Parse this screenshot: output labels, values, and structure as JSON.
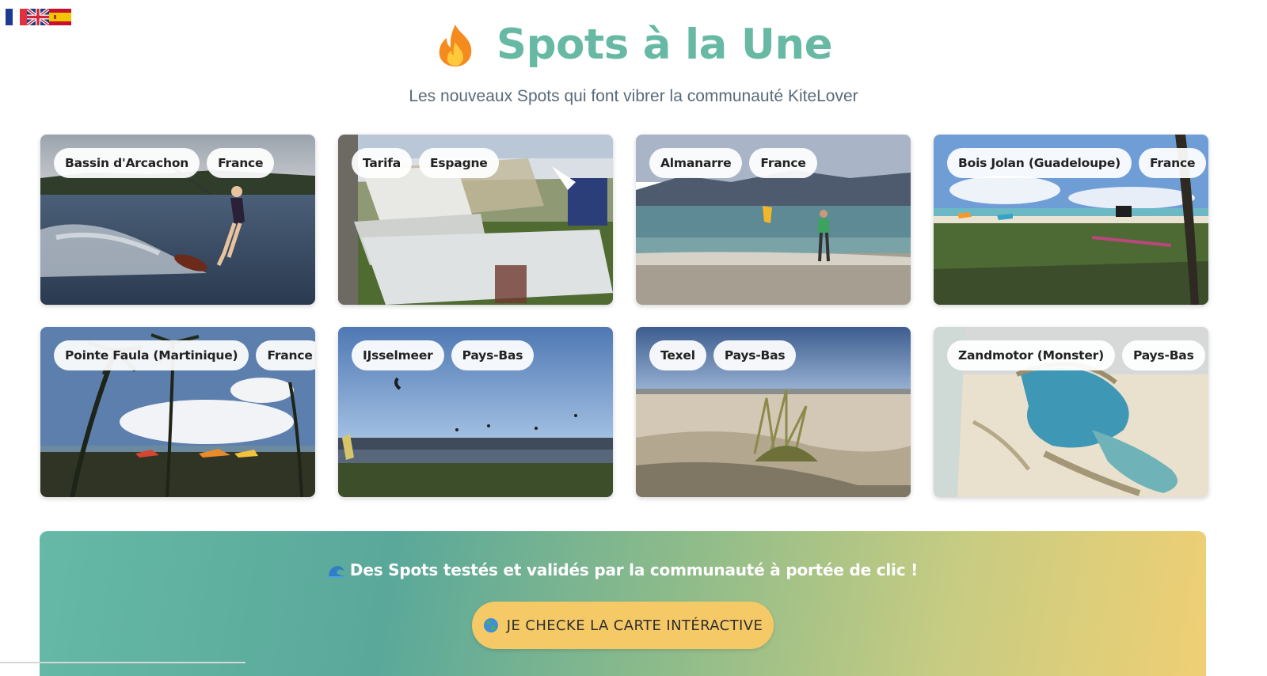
{
  "languages": [
    {
      "code": "fr",
      "icon": "france-flag-icon"
    },
    {
      "code": "en",
      "icon": "uk-flag-icon"
    },
    {
      "code": "es",
      "icon": "spain-flag-icon"
    }
  ],
  "header": {
    "icon": "fire-icon",
    "title": "Spots à la Une",
    "subtitle": "Les nouveaux Spots qui font vibrer la communauté KiteLover"
  },
  "spots": [
    {
      "name": "Bassin d'Arcachon",
      "country": "France"
    },
    {
      "name": "Tarifa",
      "country": "Espagne"
    },
    {
      "name": "Almanarre",
      "country": "France"
    },
    {
      "name": "Bois Jolan (Guadeloupe)",
      "country": "France"
    },
    {
      "name": "Pointe Faula (Martinique)",
      "country": "France"
    },
    {
      "name": "IJsselmeer",
      "country": "Pays-Bas"
    },
    {
      "name": "Texel",
      "country": "Pays-Bas"
    },
    {
      "name": "Zandmotor (Monster)",
      "country": "Pays-Bas"
    }
  ],
  "cta": {
    "icon": "wave-icon",
    "text": "Des Spots testés et validés par la communauté à portée de clic !",
    "button_icon": "globe-icon",
    "button_label": "JE CHECKE LA CARTE INTÉRACTIVE"
  },
  "colors": {
    "title": "#67b9a4",
    "button": "#f6c967",
    "banner_start": "#66b9a6",
    "banner_end": "#f0cf74"
  }
}
